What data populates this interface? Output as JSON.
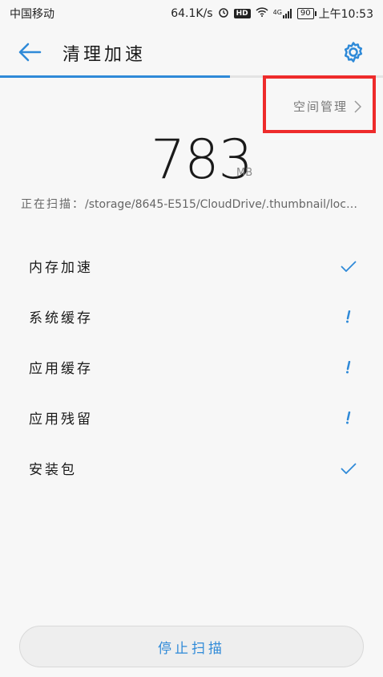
{
  "status_bar": {
    "carrier": "中国移动",
    "speed": "64.1K/s",
    "hd": "HD",
    "network": "4G",
    "battery": "90",
    "time": "上午10:53"
  },
  "header": {
    "title": "清理加速"
  },
  "scan_progress": 0.6,
  "space_management": {
    "label": "空间管理"
  },
  "size": {
    "value": "783",
    "unit": "MB"
  },
  "scan": {
    "label": "正在扫描：",
    "path": "/storage/8645-E515/CloudDrive/.thumbnail/local…"
  },
  "items": [
    {
      "label": "内存加速",
      "status": "done"
    },
    {
      "label": "系统缓存",
      "status": "scanning"
    },
    {
      "label": "应用缓存",
      "status": "scanning"
    },
    {
      "label": "应用残留",
      "status": "scanning"
    },
    {
      "label": "安装包",
      "status": "done"
    }
  ],
  "stop_button": {
    "label": "停止扫描"
  },
  "colors": {
    "accent": "#2f8ad8",
    "highlight": "#ee2b2b"
  }
}
